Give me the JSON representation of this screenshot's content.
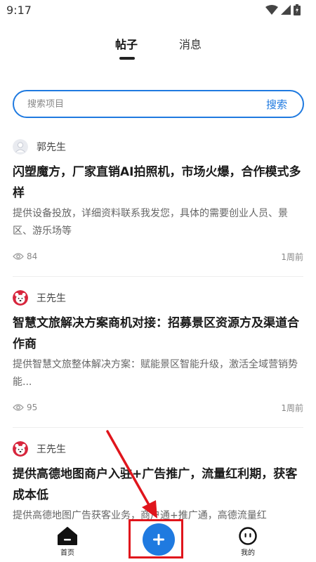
{
  "status_bar": {
    "time": "9:17"
  },
  "tabs": {
    "posts": "帖子",
    "messages": "消息"
  },
  "search": {
    "placeholder": "搜索项目",
    "button": "搜索"
  },
  "posts": [
    {
      "author": "郭先生",
      "avatar_icon": "default-user-icon",
      "title": "闪塑魔方，厂家直销AI拍照机，市场火爆，合作模式多样",
      "desc": "提供设备投放，详细资料联系我发您，具体的需要创业人员、景区、游乐场等",
      "views": "84",
      "time": "1周前"
    },
    {
      "author": "王先生",
      "avatar_icon": "bear-avatar-icon",
      "title": "智慧文旅解决方案商机对接：招募景区资源方及渠道合作商",
      "desc": "提供智慧文旅整体解决方案：赋能景区智能升级，激活全域营销势能...",
      "views": "95",
      "time": "1周前"
    },
    {
      "author": "王先生",
      "avatar_icon": "bear-avatar-icon",
      "title": "提供高德地图商户入驻+广告推广，流量红利期，获客成本低",
      "desc": "提供高德地图广告获客业务，商户通+推广通，高德流量红"
    }
  ],
  "bottom_nav": {
    "home": "首页",
    "mine": "我的"
  },
  "colors": {
    "accent": "#1f7ae0",
    "annotation": "#e0151c"
  }
}
